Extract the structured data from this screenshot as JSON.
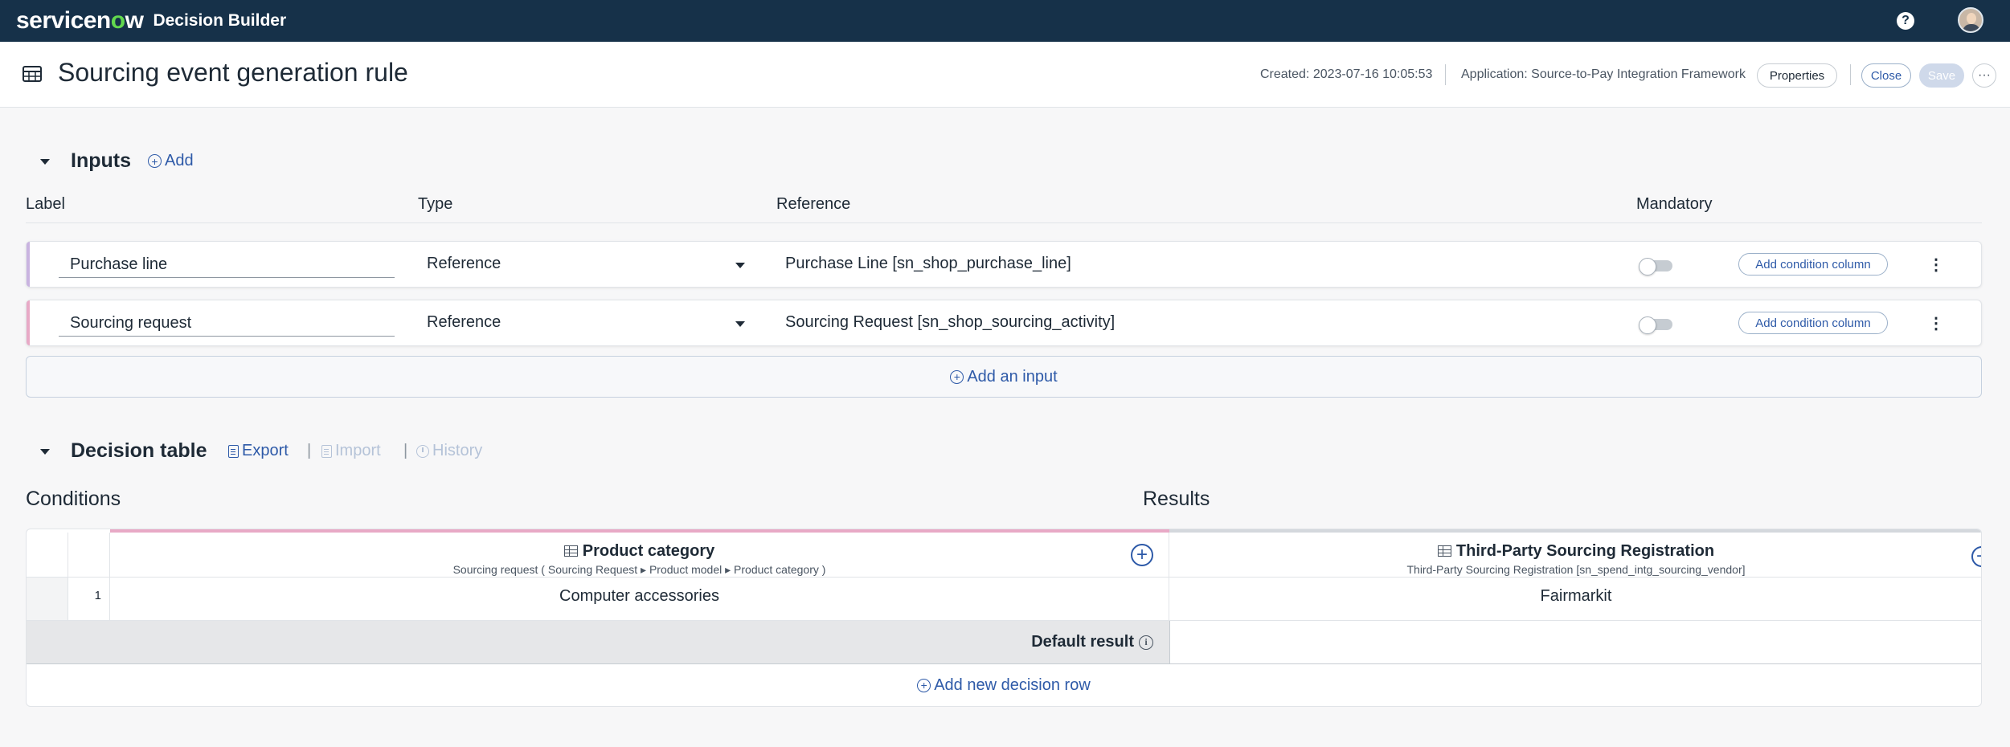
{
  "topbar": {
    "logo_prefix": "servicen",
    "logo_o": "o",
    "logo_suffix": "w",
    "app_name": "Decision Builder",
    "help_icon": "question-circle-icon",
    "bg_color": "#163149"
  },
  "record_header": {
    "title": "Sourcing event generation rule",
    "created": "Created: 2023-07-16 10:05:53",
    "application": "Application: Source-to-Pay Integration Framework",
    "properties_label": "Properties",
    "close_label": "Close",
    "save_label": "Save",
    "more_label": "···"
  },
  "inputs": {
    "title": "Inputs",
    "add_label": "Add",
    "columns": {
      "label": "Label",
      "type": "Type",
      "reference": "Reference",
      "mandatory": "Mandatory"
    },
    "rows": [
      {
        "label": "Purchase line",
        "type": "Reference",
        "reference": "Purchase Line [sn_shop_purchase_line]",
        "mandatory": false,
        "add_condition": "Add condition column",
        "accent": "#c9b3e0"
      },
      {
        "label": "Sourcing request",
        "type": "Reference",
        "reference": "Sourcing Request [sn_shop_sourcing_activity]",
        "mandatory": false,
        "add_condition": "Add condition column",
        "accent": "#e8a9c6"
      }
    ],
    "add_input_label": "Add an input"
  },
  "decision_table": {
    "title": "Decision table",
    "export_label": "Export",
    "import_label": "Import",
    "history_label": "History",
    "separator": "|",
    "conditions_label": "Conditions",
    "results_label": "Results",
    "condition_column": {
      "title": "Product category",
      "subtitle": "Sourcing request ( Sourcing Request ▸ Product model ▸ Product category )"
    },
    "result_column": {
      "title": "Third-Party Sourcing Registration",
      "subtitle": "Third-Party Sourcing Registration [sn_spend_intg_sourcing_vendor]"
    },
    "rows": [
      {
        "number": "1",
        "condition": "Computer accessories",
        "result": "Fairmarkit"
      }
    ],
    "default_result_label": "Default result",
    "default_result_value": "",
    "add_row_label": "Add new decision row"
  }
}
